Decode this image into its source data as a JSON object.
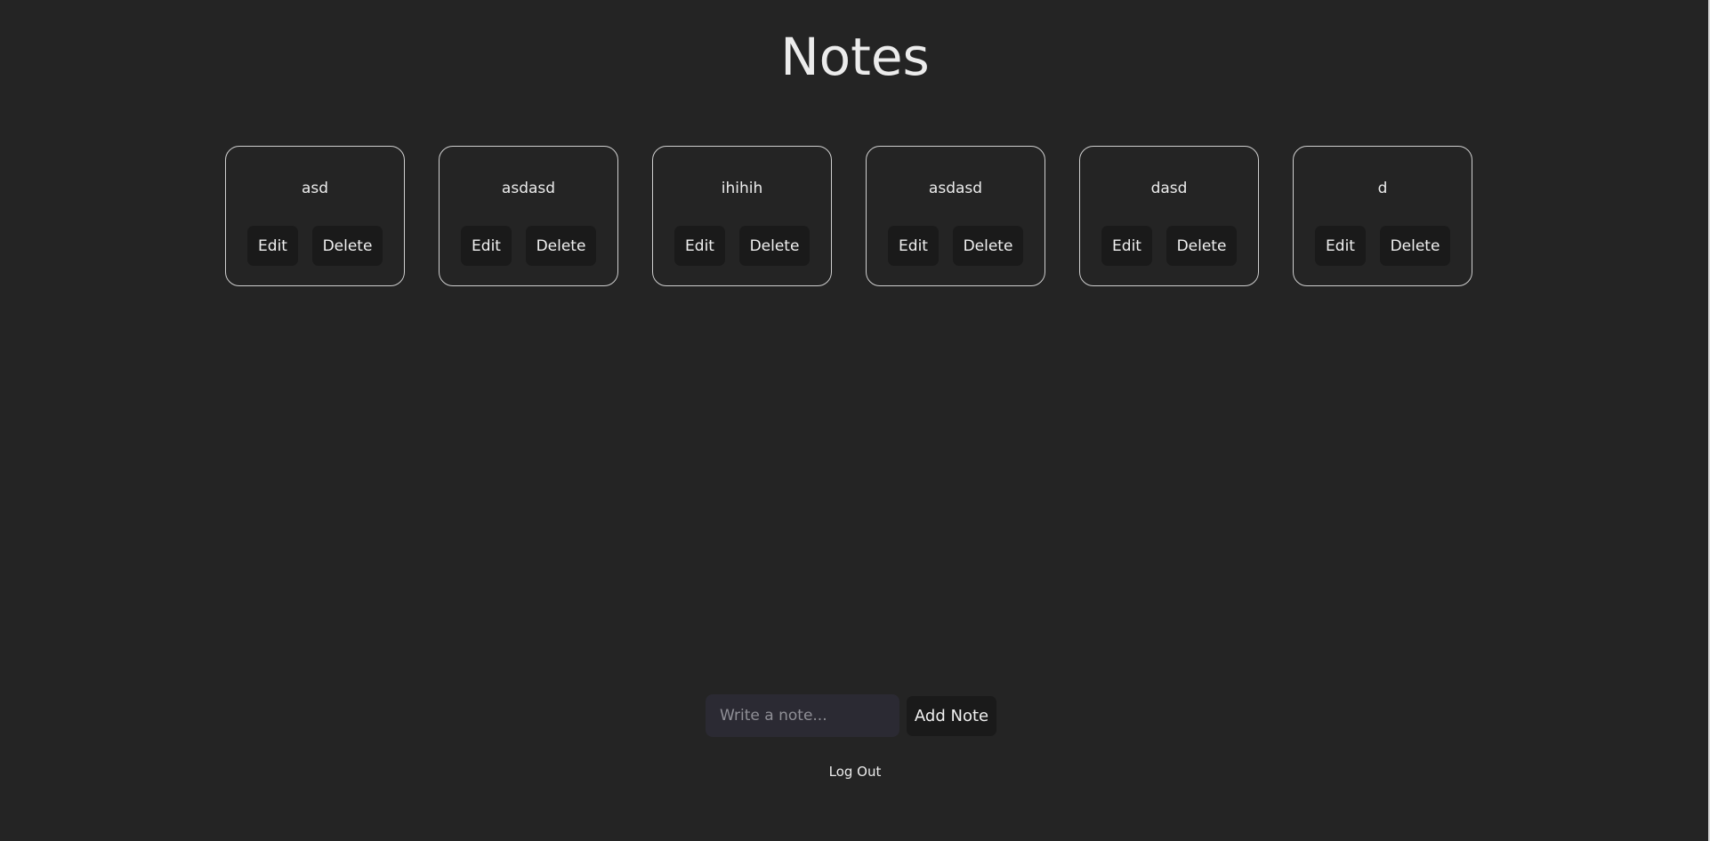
{
  "header": {
    "title": "Notes"
  },
  "notes": [
    {
      "text": "asd",
      "edit_label": "Edit",
      "delete_label": "Delete"
    },
    {
      "text": "asdasd",
      "edit_label": "Edit",
      "delete_label": "Delete"
    },
    {
      "text": "ihihih",
      "edit_label": "Edit",
      "delete_label": "Delete"
    },
    {
      "text": "asdasd",
      "edit_label": "Edit",
      "delete_label": "Delete"
    },
    {
      "text": "dasd",
      "edit_label": "Edit",
      "delete_label": "Delete"
    },
    {
      "text": "d",
      "edit_label": "Edit",
      "delete_label": "Delete"
    }
  ],
  "composer": {
    "value": "",
    "placeholder": "Write a note...",
    "add_label": "Add Note"
  },
  "footer": {
    "logout_label": "Log Out"
  },
  "colors": {
    "background": "#242424",
    "text": "#ececec",
    "card_border": "#cfcfcf",
    "button_bg": "#1a1a1a",
    "input_bg": "#2b2a33"
  }
}
